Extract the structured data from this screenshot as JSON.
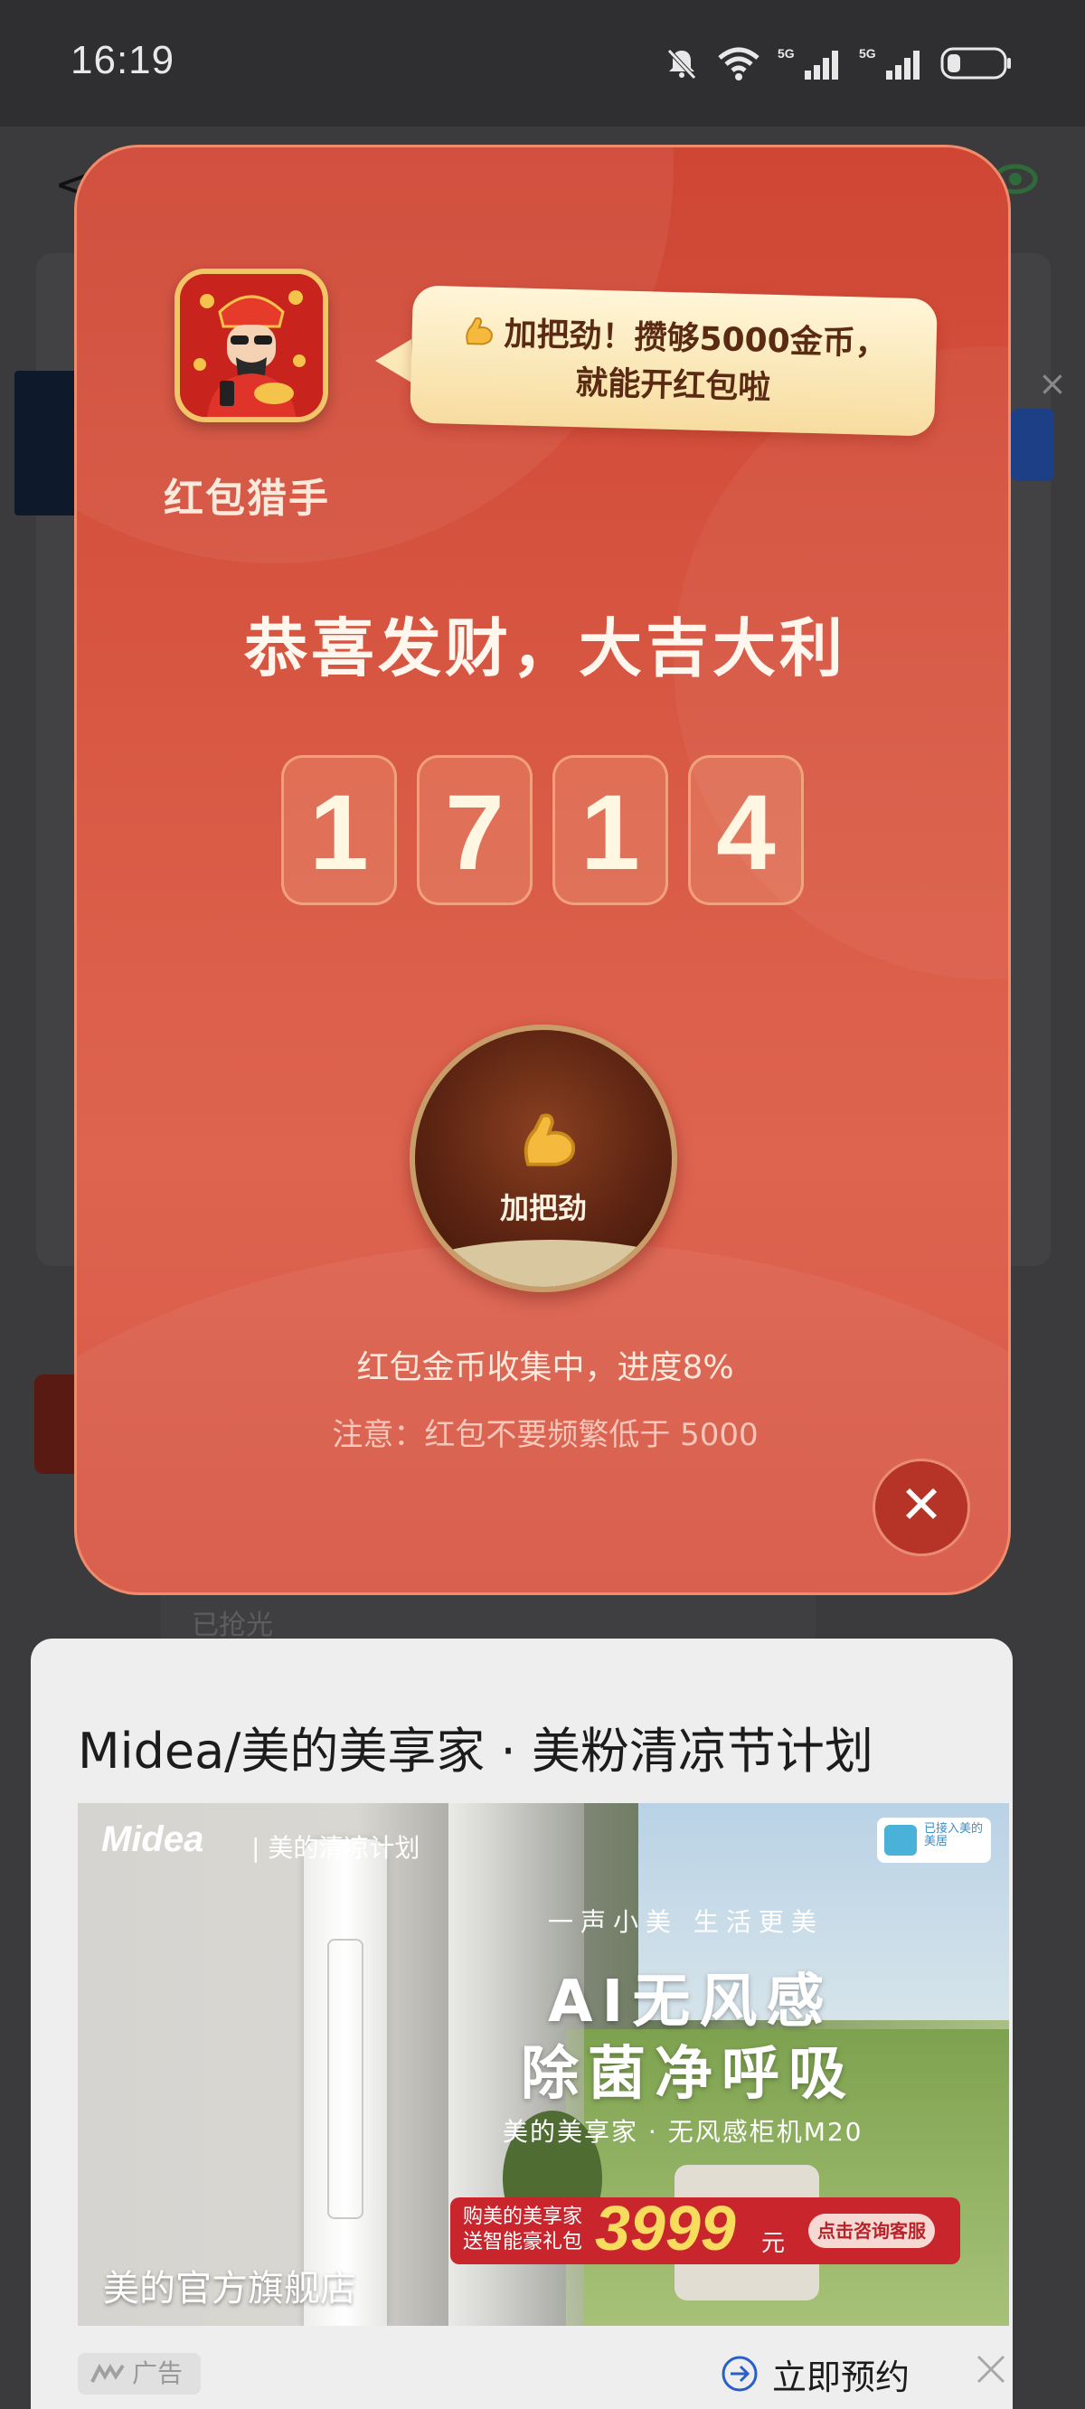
{
  "status_bar": {
    "time": "16:19"
  },
  "background": {
    "back_glyph": "<",
    "grabbed_label": "已抢光"
  },
  "popup": {
    "app_name": "红包猎手",
    "speech_line1": "加把劲！攒够5000金币，",
    "speech_line2": "就能开红包啦",
    "headline": "恭喜发财，大吉大利",
    "digits": [
      "1",
      "7",
      "1",
      "4"
    ],
    "boost_label": "加把劲",
    "progress_text": "红包金币收集中，进度8%",
    "progress_percent": 8,
    "notice_text": "注意：红包不要频繁低于 5000",
    "close_glyph": "✕"
  },
  "ad": {
    "title": "Midea/美的美享家 · 美粉清凉节计划",
    "image": {
      "logo": "Midea",
      "logo_sub": "| 美的清凉计划",
      "badge": "已接入美的美居",
      "slogan": "一声小美 生活更美",
      "headline1": "AI无风感",
      "headline2": "除菌净呼吸",
      "product": "美的美享家 · 无风感柜机M20",
      "price_lead1": "购美的美享家",
      "price_lead2": "送智能豪礼包",
      "price": "3999",
      "price_unit": "元",
      "cta": "点击咨询客服",
      "store": "美的官方旗舰店"
    },
    "tag": "广告",
    "action": "立即预约"
  }
}
